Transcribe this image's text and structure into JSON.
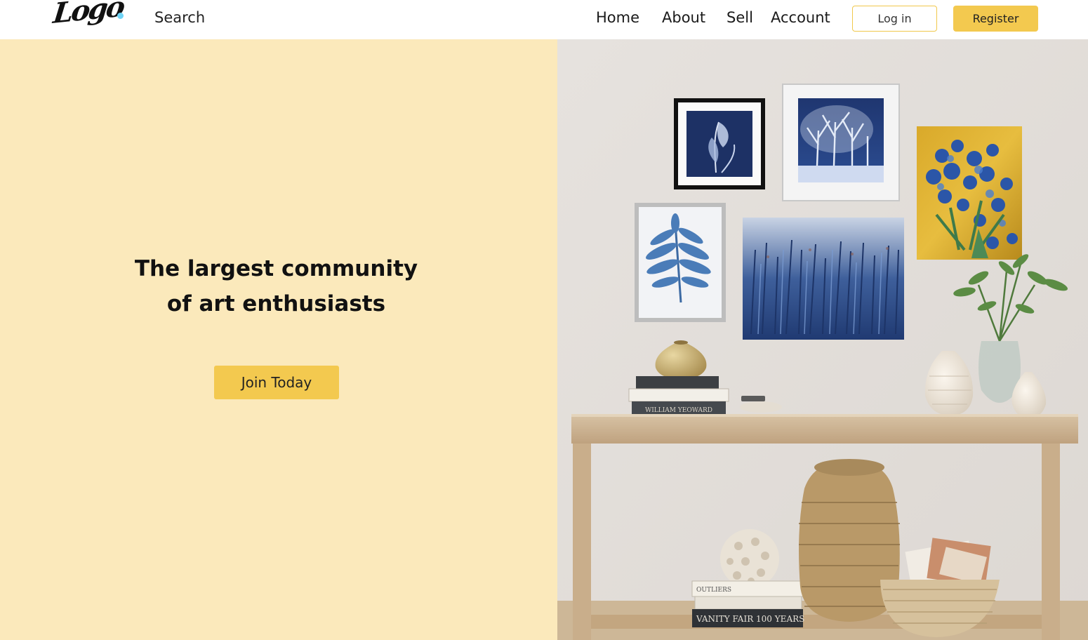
{
  "header": {
    "logo_text": "Logo",
    "search_label": "Search",
    "nav": {
      "home": "Home",
      "about": "About",
      "sell": "Sell",
      "account": "Account"
    },
    "login_label": "Log in",
    "register_label": "Register"
  },
  "hero": {
    "headline_line1": "The largest community",
    "headline_line2": "of art enthusiasts",
    "cta_label": "Join Today",
    "image": {
      "book_spine_upper": "WILLIAM YEOWARD",
      "book_spine_lower": "VANITY FAIR 100 YEARS",
      "book_spine_middle": "OUTLIERS"
    }
  },
  "colors": {
    "accent": "#f3c94f",
    "hero_background": "#fbe9bb",
    "logo_dot": "#6fd3f5"
  }
}
